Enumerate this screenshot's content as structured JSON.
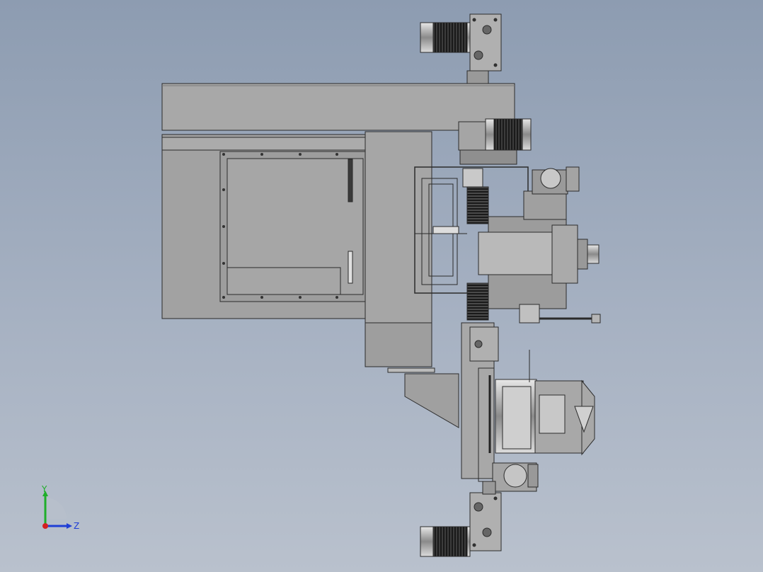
{
  "viewport": {
    "background_top": "#8d9cb1",
    "background_bottom": "#b9c1cd"
  },
  "triad": {
    "y_label": "Y",
    "z_label": "Z",
    "y_color": "#1fae2a",
    "z_color": "#1f3ed6",
    "x_color": "#d42020"
  },
  "model": {
    "fill": "#a4a4a4",
    "dark_fill": "#3a3a3a",
    "stroke": "#2b2b2b",
    "metal": "#d8d8d8"
  }
}
